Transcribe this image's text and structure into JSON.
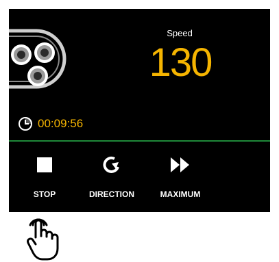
{
  "speed": {
    "label": "Speed",
    "value": "130"
  },
  "timer": {
    "icon": "clock-icon",
    "elapsed": "00:09:56"
  },
  "controls": [
    {
      "label": "STOP",
      "icon": "stop-icon"
    },
    {
      "label": "DIRECTION",
      "icon": "rotate-icon"
    },
    {
      "label": "MAXIMUM",
      "icon": "fast-forward-icon"
    }
  ],
  "colors": {
    "accent": "#f5b400",
    "divider": "#1f8a3a",
    "background": "#000000"
  },
  "hint_icon": "tap-hand-icon"
}
